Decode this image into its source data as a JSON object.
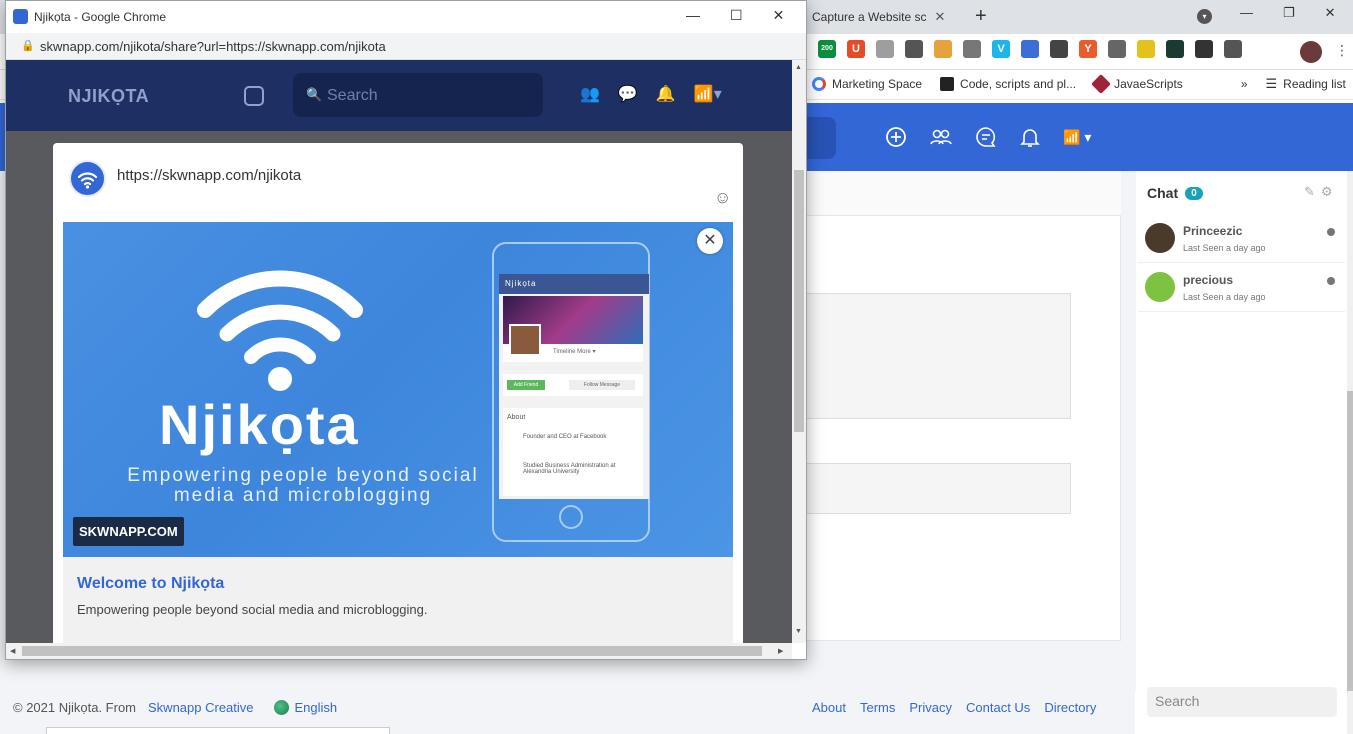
{
  "background_browser": {
    "tab_title": "Capture a Website sc",
    "new_tab": "+",
    "profile_initial": "",
    "extensions": [
      {
        "name": "badge-200",
        "label": "200",
        "color": "#0a8f3c"
      },
      {
        "name": "ublock",
        "label": "U",
        "color": "#e34c26"
      },
      {
        "name": "ext-gray",
        "label": "",
        "color": "#9e9e9e"
      },
      {
        "name": "hubspot",
        "label": "",
        "color": "#555"
      },
      {
        "name": "notes",
        "label": "",
        "color": "#e6a23c"
      },
      {
        "name": "ext-square",
        "label": "",
        "color": "#777"
      },
      {
        "name": "vimeo",
        "label": "V",
        "color": "#1ab7ea"
      },
      {
        "name": "undo",
        "label": "",
        "color": "#3b6ed6"
      },
      {
        "name": "eyedropper",
        "label": "",
        "color": "#444"
      },
      {
        "name": "ya",
        "label": "Y",
        "color": "#e85d2b"
      },
      {
        "name": "settings",
        "label": "",
        "color": "#666"
      },
      {
        "name": "ext-yellow",
        "label": "",
        "color": "#e4c21c"
      },
      {
        "name": "monitor",
        "label": "",
        "color": "#1b3a32"
      },
      {
        "name": "zoom",
        "label": "",
        "color": "#333"
      },
      {
        "name": "puzzle",
        "label": "",
        "color": "#555"
      }
    ],
    "bookmarks": [
      "Marketing Space",
      "Code, scripts and pl...",
      "JavaeScripts"
    ],
    "bookmarks_more": "»",
    "reading_list": "Reading list"
  },
  "chat": {
    "title": "Chat",
    "count": "0",
    "users": [
      {
        "name": "Princeezic",
        "seen": "Last Seen a day ago",
        "avatar_color": "#4a3a2c"
      },
      {
        "name": "precious",
        "seen": "Last Seen a day ago",
        "avatar_color": "#7ec242"
      }
    ],
    "search_placeholder": "Search"
  },
  "footer": {
    "copyright": "© 2021 Njikọta. From",
    "creator": "Skwnapp Creative",
    "language": "English",
    "links": [
      "About",
      "Terms",
      "Privacy",
      "Contact Us",
      "Directory"
    ]
  },
  "popup": {
    "window_title": "Njikọta - Google Chrome",
    "url": "skwnapp.com/njikota/share?url=https://skwnapp.com/njikota",
    "site": {
      "logo": "NJIKỌTA",
      "search_placeholder": "Search"
    },
    "modal": {
      "share_url": "https://skwnapp.com/njikota",
      "banner_brand": "Njikọta",
      "banner_tagline": "Empowering people beyond social media and microblogging",
      "banner_site": "SKWNAPP.COM",
      "phone": {
        "bar_title": "Njikọta",
        "tabs": "Timeline   More ▾",
        "add_friend": "Add Friend",
        "follow": "Follow   Message",
        "about": "About",
        "line1": "Founder and CEO at Facebook",
        "line2": "Studied Business Administration at Alexandria University"
      },
      "title": "Welcome to Njikọta",
      "description": "Empowering people beyond social media and microblogging."
    }
  }
}
